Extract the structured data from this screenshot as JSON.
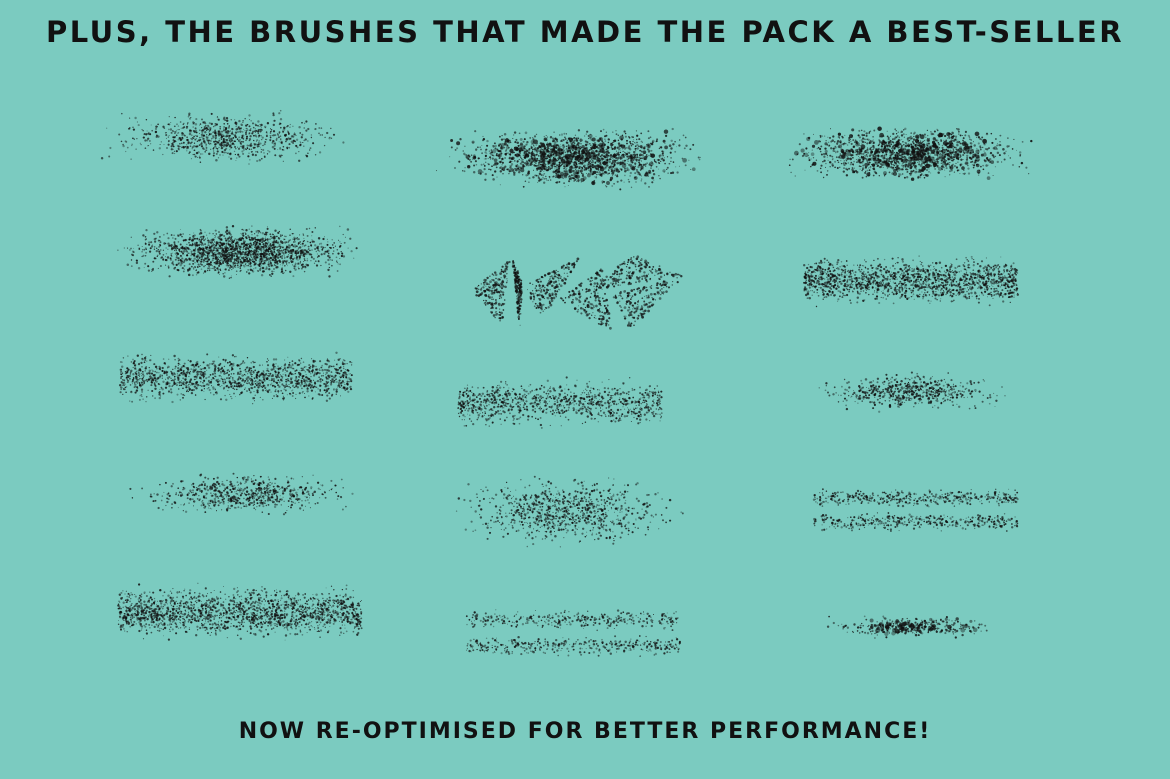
{
  "headline": "PLUS, THE BRUSHES THAT MADE THE PACK A BEST-SELLER",
  "footer": "NOW RE-OPTIMISED FOR BETTER PERFORMANCE!",
  "colors": {
    "background": "#7bcbc0",
    "ink": "#111111"
  },
  "brush_strokes": [
    {
      "name": "brush-stroke-1",
      "density": 0.35,
      "style": "faint-scatter"
    },
    {
      "name": "brush-stroke-2",
      "density": 0.8,
      "style": "dense-spray"
    },
    {
      "name": "brush-stroke-3",
      "density": 0.8,
      "style": "dense-rounded"
    },
    {
      "name": "brush-stroke-4",
      "density": 0.4,
      "style": "fine-scatter"
    },
    {
      "name": "brush-stroke-5",
      "density": 0.9,
      "style": "dense-rounded"
    },
    {
      "name": "brush-stroke-6",
      "density": 0.6,
      "style": "coarse-scatter"
    },
    {
      "name": "brush-stroke-7",
      "density": 0.5,
      "style": "triangle-shards"
    },
    {
      "name": "brush-stroke-8",
      "density": 0.65,
      "style": "rounded-spray"
    },
    {
      "name": "brush-stroke-9",
      "density": 0.3,
      "style": "wide-scatter"
    },
    {
      "name": "brush-stroke-10",
      "density": 0.45,
      "style": "layered-bands"
    },
    {
      "name": "brush-stroke-11",
      "density": 0.7,
      "style": "coarse-scatter"
    },
    {
      "name": "brush-stroke-12",
      "density": 1.0,
      "style": "dense-rounded"
    },
    {
      "name": "brush-stroke-13",
      "density": 0.45,
      "style": "fine-scatter"
    },
    {
      "name": "brush-stroke-14",
      "density": 0.6,
      "style": "banded-spray"
    },
    {
      "name": "brush-stroke-15",
      "density": 0.55,
      "style": "thin-clumps"
    }
  ]
}
